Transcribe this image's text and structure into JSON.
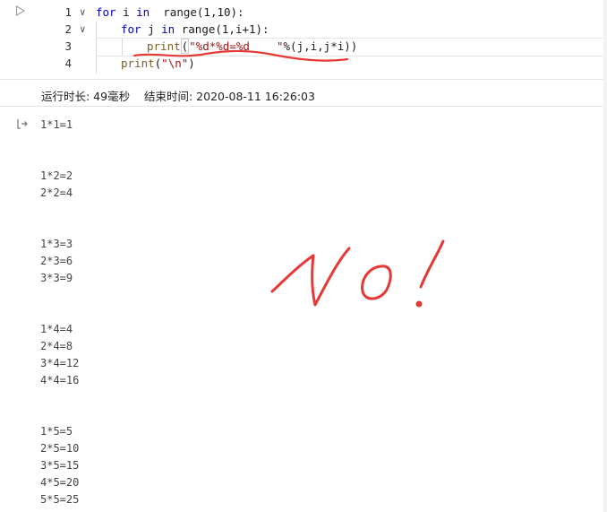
{
  "editor": {
    "lines": [
      {
        "num": "1",
        "fold": "∨"
      },
      {
        "num": "2",
        "fold": "∨"
      },
      {
        "num": "3",
        "fold": ""
      },
      {
        "num": "4",
        "fold": ""
      }
    ],
    "code": {
      "l1_kw1": "for",
      "l1_mid": " i ",
      "l1_kw2": "in",
      "l1_tail": "  range(1,10):",
      "l2_kw1": "for",
      "l2_mid": " j ",
      "l2_kw2": "in",
      "l2_tail": " range(1,i+1):",
      "l3_fn": "print",
      "l3_open": "(",
      "l3_str": "\"%d*%d=%d    \"",
      "l3_tail": "%(j,i,j*i))",
      "l4_fn": "print",
      "l4_open": "(",
      "l4_str": "\"\\n\"",
      "l4_tail": ")"
    }
  },
  "execution": {
    "run_time_label": "运行时长: 49毫秒",
    "end_time_label": "结束时间: 2020-08-11 16:26:03"
  },
  "output": {
    "groups": [
      [
        "1*1=1"
      ],
      [
        "1*2=2",
        "2*2=4"
      ],
      [
        "1*3=3",
        "2*3=6",
        "3*3=9"
      ],
      [
        "1*4=4",
        "2*4=8",
        "3*4=12",
        "4*4=16"
      ],
      [
        "1*5=5",
        "2*5=10",
        "3*5=15",
        "4*5=20",
        "5*5=25"
      ]
    ]
  },
  "annotation": {
    "text": "No!",
    "color": "#e53935"
  },
  "colors": {
    "keyword": "#0000cc",
    "string": "#a31515",
    "annotation": "#e53935"
  },
  "icons": {
    "run": "play-triangle-icon",
    "output": "output-arrow-icon"
  }
}
